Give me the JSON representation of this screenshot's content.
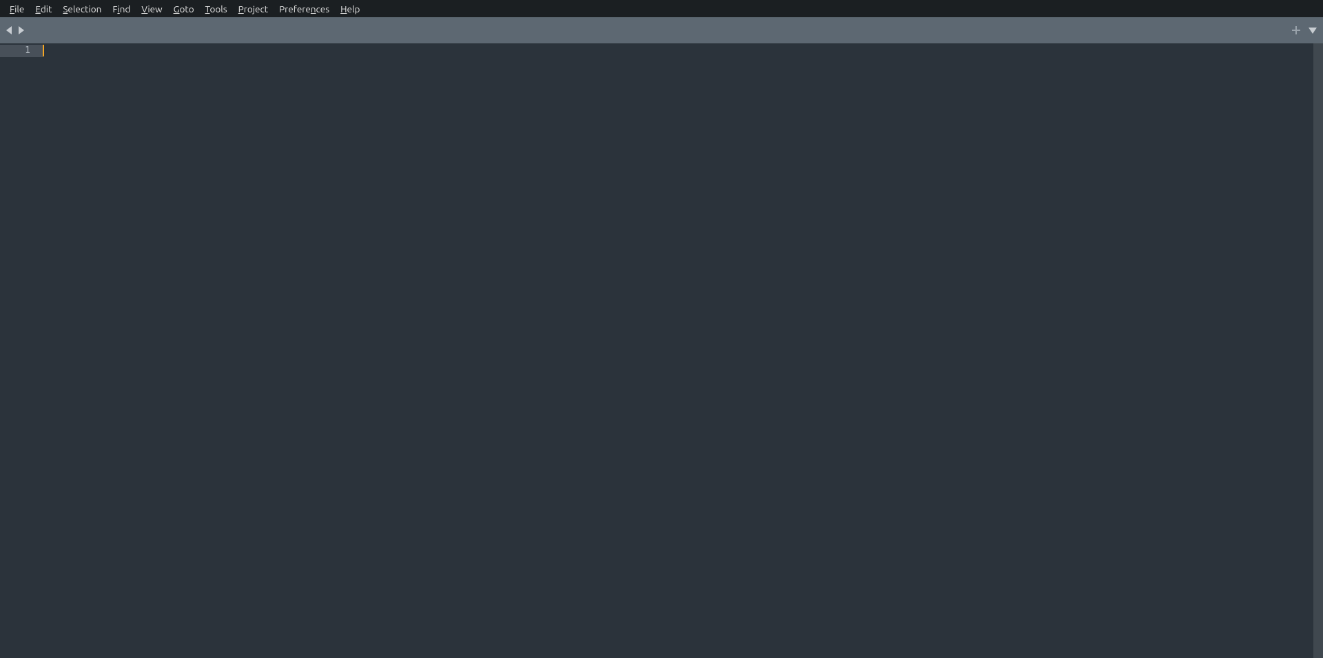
{
  "menubar": {
    "items": [
      {
        "label": "File",
        "mnemonic_index": 0
      },
      {
        "label": "Edit",
        "mnemonic_index": 0
      },
      {
        "label": "Selection",
        "mnemonic_index": 0
      },
      {
        "label": "Find",
        "mnemonic_index": 1
      },
      {
        "label": "View",
        "mnemonic_index": 0
      },
      {
        "label": "Goto",
        "mnemonic_index": 0
      },
      {
        "label": "Tools",
        "mnemonic_index": 0
      },
      {
        "label": "Project",
        "mnemonic_index": 0
      },
      {
        "label": "Preferences",
        "mnemonic_index": 7
      },
      {
        "label": "Help",
        "mnemonic_index": 0
      }
    ]
  },
  "tabbar": {
    "nav_back_icon": "triangle-left-icon",
    "nav_forward_icon": "triangle-right-icon",
    "new_tab_icon": "plus-icon",
    "tab_menu_icon": "triangle-down-icon"
  },
  "editor": {
    "gutter": {
      "visible_line_numbers": [
        "1"
      ]
    },
    "content": "",
    "caret_line": 1,
    "caret_col": 1
  },
  "colors": {
    "menubar_bg": "#1b1f22",
    "tabbar_bg": "#5d6872",
    "editor_bg": "#2b333b",
    "gutter_active_bg": "#485059",
    "caret": "#f5a623",
    "text": "#d0d0d0"
  }
}
